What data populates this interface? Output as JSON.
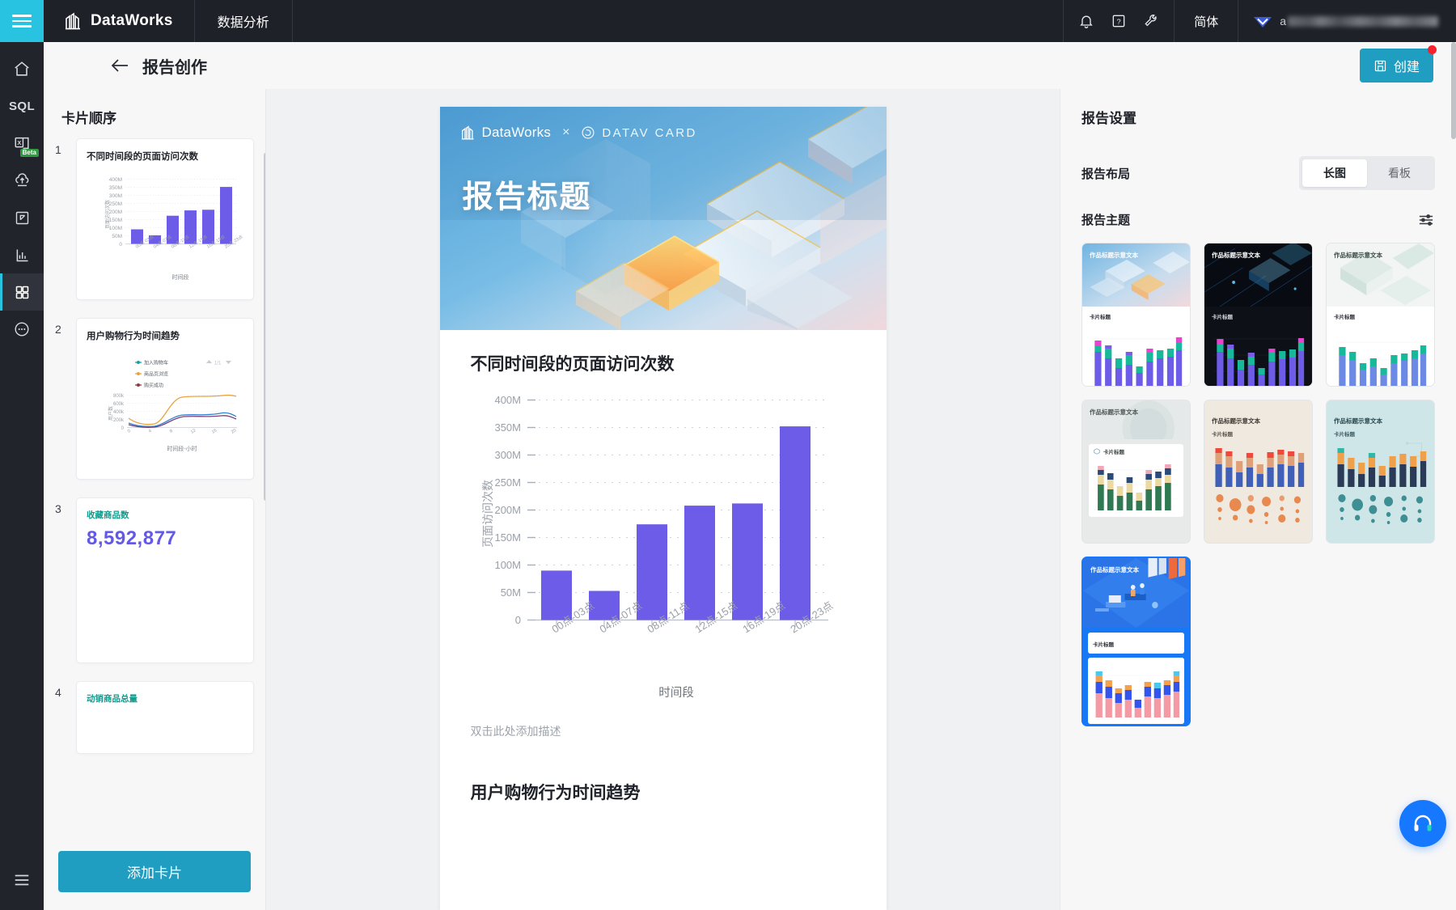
{
  "topbar": {
    "menu_icon": "hamburger-icon",
    "brand": "DataWorks",
    "nav_item": "数据分析",
    "icons": [
      "bell-icon",
      "help-icon",
      "wrench-icon"
    ],
    "language": "简体",
    "user_prefix": "a"
  },
  "rail": {
    "items": [
      {
        "name": "home",
        "icon": "home-icon",
        "badge": ""
      },
      {
        "name": "sql",
        "icon": "sql-text-icon",
        "label": "SQL",
        "badge": ""
      },
      {
        "name": "excel",
        "icon": "excel-icon",
        "badge": "Beta"
      },
      {
        "name": "upload",
        "icon": "cloud-upload-icon",
        "badge": ""
      },
      {
        "name": "component",
        "icon": "card-frame-icon",
        "badge": ""
      },
      {
        "name": "analytics",
        "icon": "bar-chart-icon",
        "badge": ""
      },
      {
        "name": "report",
        "icon": "grid-apps-icon",
        "badge": ""
      },
      {
        "name": "more",
        "icon": "more-dots-icon",
        "badge": ""
      }
    ],
    "bottom_item": {
      "name": "collapse",
      "icon": "menu-bars-icon"
    }
  },
  "page_header": {
    "back_icon": "arrow-left-icon",
    "title": "报告创作",
    "create_button": {
      "label": "创建",
      "icon": "save-disk-icon",
      "badge_color": "#f5222d"
    }
  },
  "cards_panel": {
    "title": "卡片顺序",
    "add_button": "添加卡片",
    "cards": [
      {
        "index": "1",
        "type": "bar",
        "title": "不同时间段的页面访问次数"
      },
      {
        "index": "2",
        "type": "line",
        "title": "用户购物行为时间趋势"
      },
      {
        "index": "3",
        "type": "kpi",
        "label": "收藏商品数",
        "value": "8,592,877"
      },
      {
        "index": "4",
        "type": "kpi",
        "label": "动销商品总量",
        "value": ""
      }
    ]
  },
  "report": {
    "banner": {
      "logo_left": "DataWorks",
      "separator": "×",
      "logo_right": "DATAV CARD",
      "heading": "报告标题"
    },
    "sections": [
      {
        "title": "不同时间段的页面访问次数",
        "description": "双击此处添加描述"
      },
      {
        "title": "用户购物行为时间趋势",
        "description": ""
      }
    ]
  },
  "settings": {
    "title": "报告设置",
    "layout": {
      "label": "报告布局",
      "options": [
        "长图",
        "看板"
      ],
      "selected": "长图"
    },
    "theme": {
      "label": "报告主题",
      "filter_icon": "sliders-icon",
      "sample_title": "作品标题示意文本",
      "sample_card_title": "卡片标题",
      "items": [
        {
          "name": "theme-light-blue",
          "selected": false
        },
        {
          "name": "theme-dark-tech",
          "selected": false
        },
        {
          "name": "theme-glass-white",
          "selected": false
        },
        {
          "name": "theme-soft-gray",
          "selected": false
        },
        {
          "name": "theme-warm-beige",
          "selected": false
        },
        {
          "name": "theme-teal-circuit",
          "selected": false
        },
        {
          "name": "theme-blue-office",
          "selected": true
        }
      ]
    }
  },
  "fab": {
    "name": "help-assistant-button",
    "icon": "headset-icon",
    "color": "#1677ff"
  },
  "chart_data": {
    "type": "bar",
    "title": "不同时间段的页面访问次数",
    "xlabel": "时间段",
    "ylabel": "页面访问次数",
    "categories": [
      "00点-03点",
      "04点-07点",
      "08点-11点",
      "12点-15点",
      "16点-19点",
      "20点-23点"
    ],
    "values": [
      90,
      53,
      174,
      208,
      212,
      352
    ],
    "unit": "M",
    "yticks": [
      "0",
      "50M",
      "100M",
      "150M",
      "200M",
      "250M",
      "300M",
      "350M",
      "400M"
    ],
    "ylim": [
      0,
      400
    ],
    "grid": true,
    "legend": "none",
    "bar_color": "#6c5ce7"
  },
  "mini_chart_2": {
    "type": "line",
    "title": "用户购物行为时间趋势",
    "xlabel": "时间段-小时",
    "ylabel": "用户数",
    "legend": [
      "加入购物车",
      "商品页浏览",
      "购买成功"
    ],
    "legend_colors": [
      "#18a0a0",
      "#e8a33d",
      "#8b3a3a"
    ],
    "pager": "1/1",
    "yticks": [
      "0",
      "200k",
      "400k",
      "600k",
      "800k"
    ],
    "xticks": [
      "0",
      "4",
      "8",
      "12",
      "16",
      "20"
    ]
  }
}
